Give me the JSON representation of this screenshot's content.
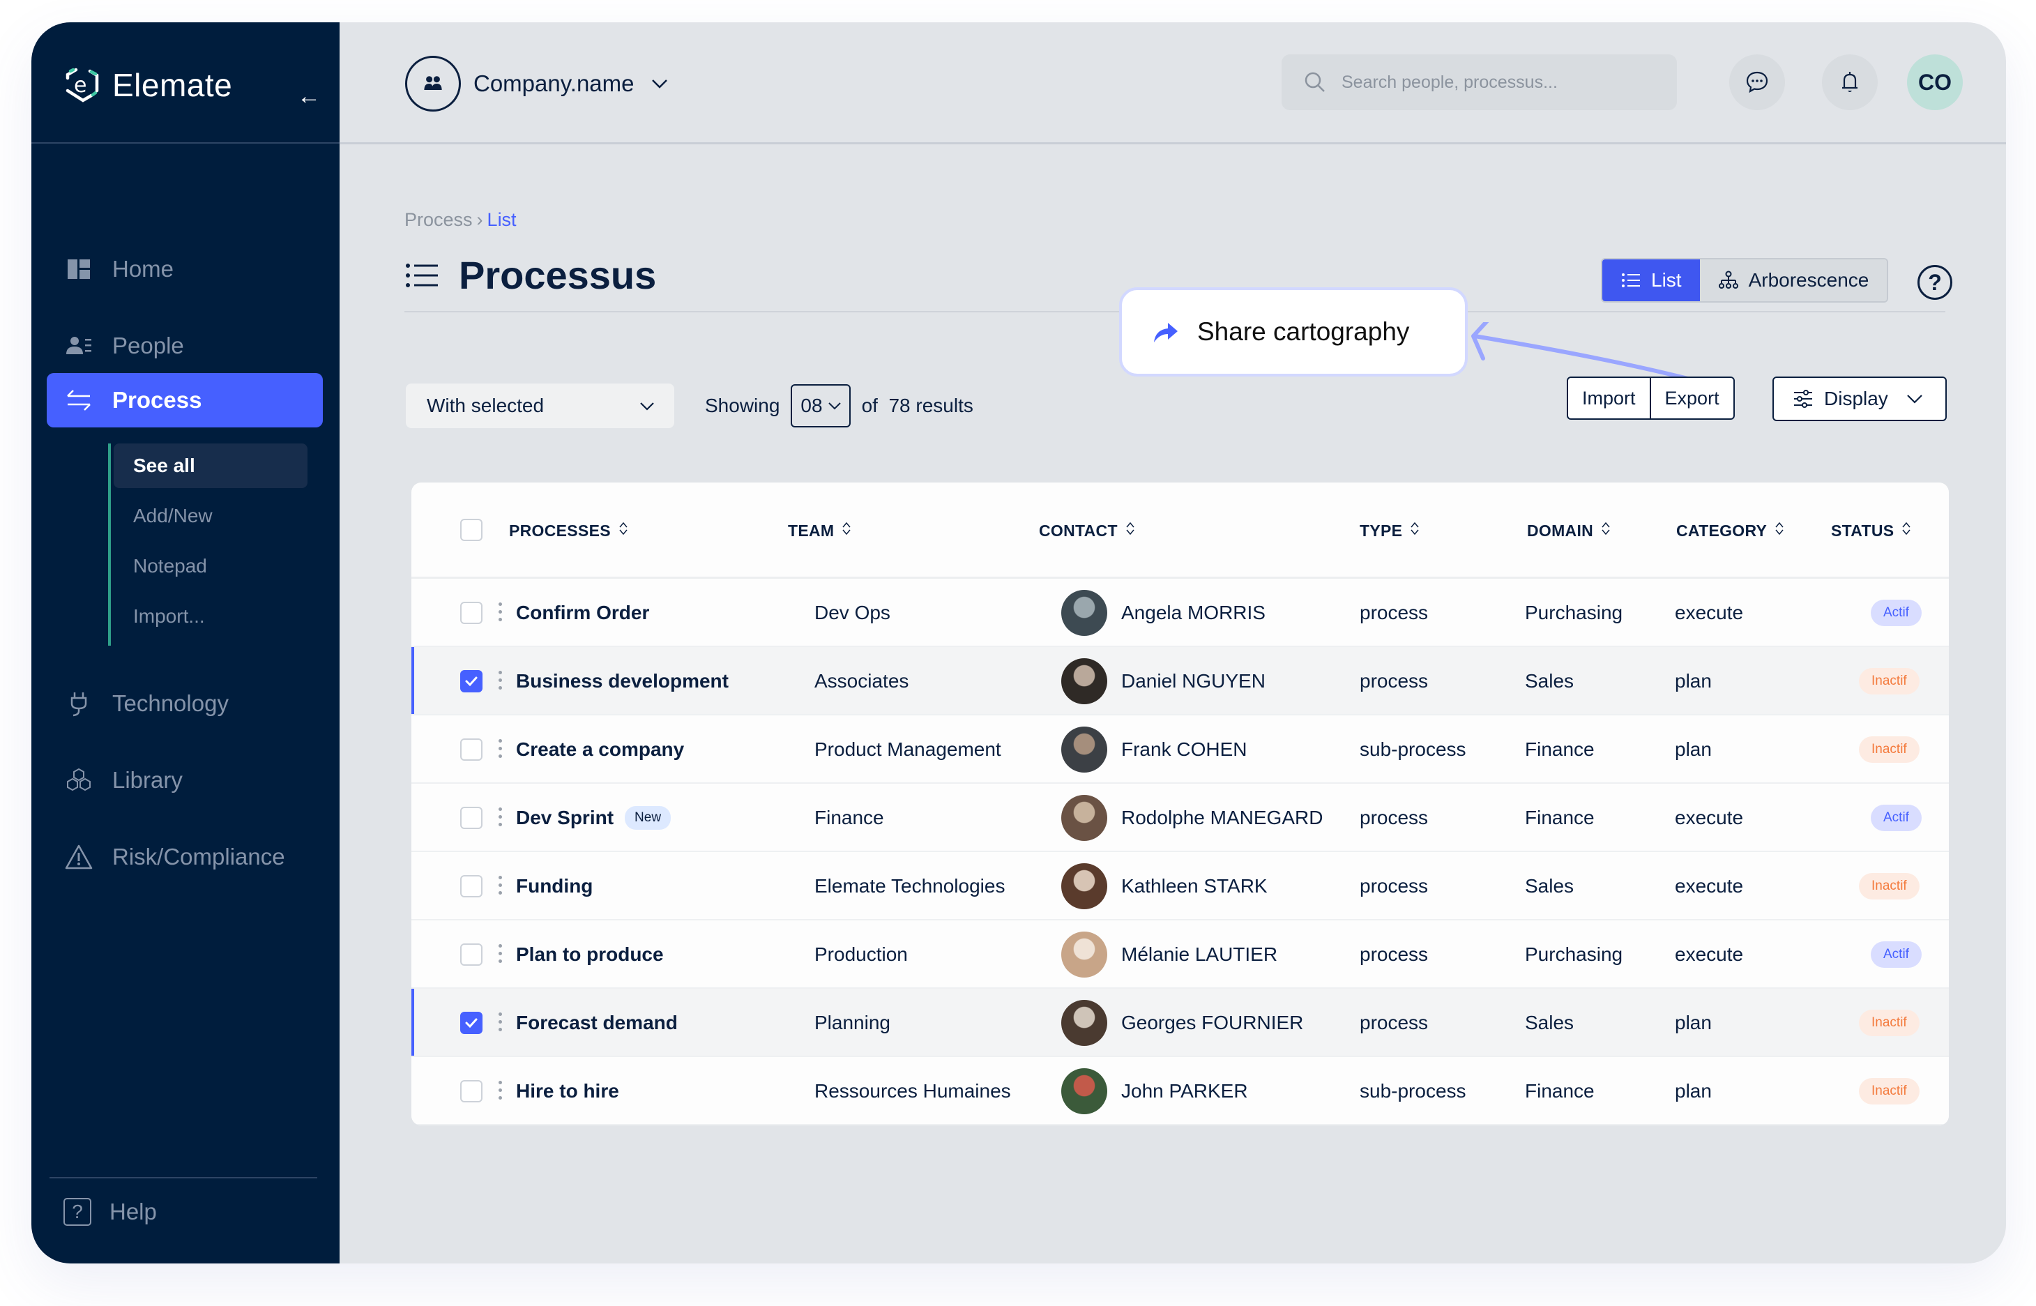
{
  "brand": {
    "name": "Elemate",
    "accent": "#4660ff",
    "sidebar_bg": "#001d3d",
    "logo_accent": "#3fc7a4"
  },
  "sidebar": {
    "items": [
      {
        "label": "Home",
        "icon": "dashboard-icon"
      },
      {
        "label": "People",
        "icon": "people-list-icon"
      },
      {
        "label": "Process",
        "icon": "swap-arrows-icon",
        "active": true
      },
      {
        "label": "Technology",
        "icon": "plug-icon"
      },
      {
        "label": "Library",
        "icon": "cubes-icon"
      },
      {
        "label": "Risk/Compliance",
        "icon": "warning-icon"
      }
    ],
    "subitems": [
      {
        "label": "See all",
        "active": true
      },
      {
        "label": "Add/New"
      },
      {
        "label": "Notepad"
      },
      {
        "label": "Import..."
      }
    ],
    "help_label": "Help"
  },
  "topbar": {
    "company_name": "Company.name",
    "search_placeholder": "Search people, processus...",
    "avatar_initials": "CO"
  },
  "page": {
    "breadcrumb": [
      "Process",
      "List"
    ],
    "title": "Processus",
    "view_options": [
      "List",
      "Arborescence"
    ],
    "active_view": "List",
    "share_label": "Share cartography",
    "with_selected_label": "With selected",
    "showing_label": "Showing",
    "per_page": "08",
    "results_label": "of  78 results",
    "import_label": "Import",
    "export_label": "Export",
    "display_label": "Display"
  },
  "table": {
    "columns": [
      "PROCESSES",
      "TEAM",
      "CONTACT",
      "TYPE",
      "DOMAIN",
      "CATEGORY",
      "STATUS"
    ],
    "rows": [
      {
        "process": "Confirm Order",
        "badge": "",
        "team": "Dev Ops",
        "contact": "Angela MORRIS",
        "type": "process",
        "domain": "Purchasing",
        "category": "execute",
        "status": "Actif",
        "checked": false
      },
      {
        "process": "Business development",
        "badge": "",
        "team": "Associates",
        "contact": "Daniel NGUYEN",
        "type": "process",
        "domain": "Sales",
        "category": "plan",
        "status": "Inactif",
        "checked": true
      },
      {
        "process": "Create a company",
        "badge": "",
        "team": "Product Management",
        "contact": "Frank COHEN",
        "type": "sub-process",
        "domain": "Finance",
        "category": "plan",
        "status": "Inactif",
        "checked": false
      },
      {
        "process": "Dev Sprint",
        "badge": "New",
        "team": "Finance",
        "contact": "Rodolphe MANEGARD",
        "type": "process",
        "domain": "Finance",
        "category": "execute",
        "status": "Actif",
        "checked": false
      },
      {
        "process": "Funding",
        "badge": "",
        "team": "Elemate Technologies",
        "contact": "Kathleen STARK",
        "type": "process",
        "domain": "Sales",
        "category": "execute",
        "status": "Inactif",
        "checked": false
      },
      {
        "process": "Plan to produce",
        "badge": "",
        "team": "Production",
        "contact": "Mélanie LAUTIER",
        "type": "process",
        "domain": "Purchasing",
        "category": "execute",
        "status": "Actif",
        "checked": false
      },
      {
        "process": "Forecast demand",
        "badge": "",
        "team": "Planning",
        "contact": "Georges FOURNIER",
        "type": "process",
        "domain": "Sales",
        "category": "plan",
        "status": "Inactif",
        "checked": true
      },
      {
        "process": "Hire to hire",
        "badge": "",
        "team": "Ressources Humaines",
        "contact": "John PARKER",
        "type": "sub-process",
        "domain": "Finance",
        "category": "plan",
        "status": "Inactif",
        "checked": false
      }
    ]
  }
}
